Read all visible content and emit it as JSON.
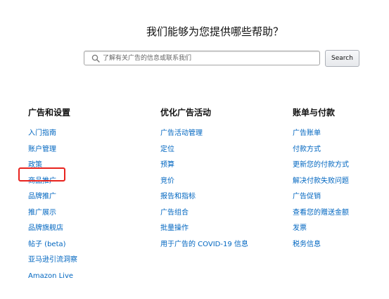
{
  "header": {
    "title": "我们能够为您提供哪些帮助？"
  },
  "search": {
    "placeholder": "了解有关广告的信息或联系我们",
    "value": "",
    "button_label": "Search",
    "icon": "search-icon"
  },
  "columns": [
    {
      "title": "广告和设置",
      "links": [
        "入门指南",
        "账户管理",
        "政策",
        "商品推广",
        "品牌推广",
        "推广展示",
        "品牌旗舰店",
        "帖子 (beta)",
        "亚马逊引流洞察",
        "Amazon Live"
      ]
    },
    {
      "title": "优化广告活动",
      "links": [
        "广告活动管理",
        "定位",
        "预算",
        "竞价",
        "报告和指标",
        "广告组合",
        "批量操作",
        "用于广告的 COVID-19 信息"
      ]
    },
    {
      "title": "账单与付款",
      "links": [
        "广告账单",
        "付款方式",
        "更新您的付款方式",
        "解决付款失败问题",
        "广告促销",
        "查看您的赠送金额",
        "发票",
        "税务信息"
      ]
    }
  ],
  "annotation": {
    "color": "#e8231e",
    "highlighted_link": "商品推广"
  },
  "colors": {
    "link": "#0066c0",
    "heading": "#111111"
  }
}
